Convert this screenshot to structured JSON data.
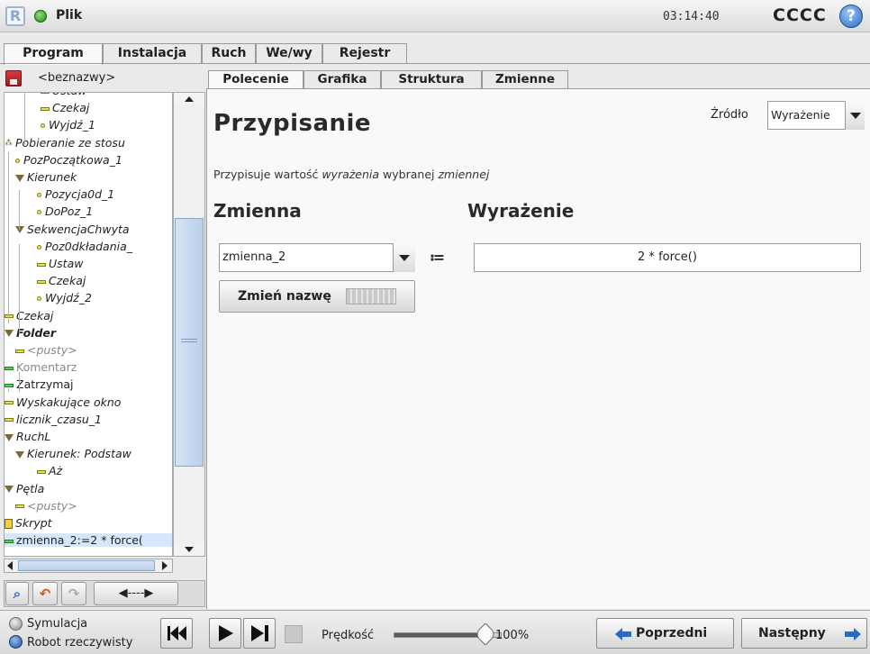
{
  "header": {
    "file_label": "Plik",
    "clock": "03:14:40",
    "robot_name": "CCCC",
    "help_glyph": "?"
  },
  "main_tabs": [
    "Program",
    "Instalacja",
    "Ruch",
    "We/wy",
    "Rejestr"
  ],
  "left_panel": {
    "program_name": "<beznazwy>",
    "tree": [
      {
        "label": "Ustaw",
        "icon": "bar-yellow"
      },
      {
        "label": "Czekaj",
        "icon": "bar-yellow"
      },
      {
        "label": "Wyjdź_1",
        "icon": "dot"
      },
      {
        "label": "Pobieranie ze stosu",
        "icon": "pick"
      },
      {
        "label": "PozPoczątkowa_1",
        "icon": "dot"
      },
      {
        "label": "Kierunek",
        "icon": "triangle"
      },
      {
        "label": "Pozycja0d_1",
        "icon": "dot"
      },
      {
        "label": "DoPoz_1",
        "icon": "dot"
      },
      {
        "label": "SekwencjaChwyta",
        "icon": "triangle"
      },
      {
        "label": "Poz0dkładania_",
        "icon": "dot"
      },
      {
        "label": "Ustaw",
        "icon": "bar-yellow"
      },
      {
        "label": "Czekaj",
        "icon": "bar-yellow"
      },
      {
        "label": "Wyjdź_2",
        "icon": "dot"
      },
      {
        "label": "Czekaj",
        "icon": "bar-yellow"
      },
      {
        "label": "Folder",
        "icon": "triangle"
      },
      {
        "label": "<pusty>",
        "icon": "bar-yellow"
      },
      {
        "label": "Komentarz",
        "icon": "bar-green"
      },
      {
        "label": "Zatrzymaj",
        "icon": "bar-green"
      },
      {
        "label": "Wyskakujące okno",
        "icon": "bar-yellow"
      },
      {
        "label": "licznik_czasu_1",
        "icon": "bar-yellow"
      },
      {
        "label": "RuchL",
        "icon": "triangle"
      },
      {
        "label": "Kierunek: Podstaw",
        "icon": "triangle"
      },
      {
        "label": "Aż",
        "icon": "bar-yellow"
      },
      {
        "label": "Pętla",
        "icon": "triangle"
      },
      {
        "label": "<pusty>",
        "icon": "bar-yellow"
      },
      {
        "label": "Skrypt",
        "icon": "script"
      },
      {
        "label": "zmienna_2:=2 * force(",
        "icon": "bar-green"
      }
    ],
    "tools": {
      "search_icon": "magnifier-icon",
      "undo_icon": "undo-arrow-icon",
      "redo_icon": "redo-arrow-icon",
      "move_label": "◀----▶"
    }
  },
  "sub_tabs": [
    "Polecenie",
    "Grafika",
    "Struktura",
    "Zmienne"
  ],
  "content": {
    "title": "Przypisanie",
    "source_label": "Źródło",
    "source_value": "Wyrażenie",
    "description_prefix": "Przypisuje wartość ",
    "description_expr": "wyrażenia",
    "description_mid": " wybranej ",
    "description_var": "zmiennej",
    "variable_header": "Zmienna",
    "expression_header": "Wyrażenie",
    "variable_value": "zmienna_2",
    "assign_symbol": "≔",
    "expression_value": "2 * force()",
    "rename_label": "Zmień nazwę"
  },
  "bottom": {
    "simulation_label": "Symulacja",
    "real_robot_label": "Robot rzeczywisty",
    "speed_label": "Prędkość",
    "speed_value": "100%",
    "speed_percent": 100,
    "prev_label": "Poprzedni",
    "next_label": "Następny"
  },
  "colors": {
    "accent_blue": "#2a6bc2",
    "status_green": "#1e8a12"
  }
}
